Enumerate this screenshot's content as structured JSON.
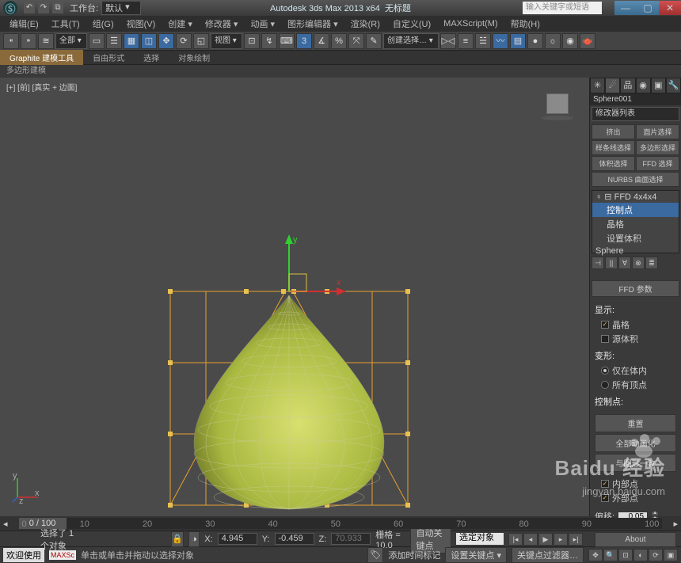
{
  "title": {
    "workspace_label": "工作台:",
    "workspace_value": "默认",
    "app": "Autodesk 3ds Max  2013 x64",
    "doc": "无标题",
    "search_placeholder": "输入关键字或短语"
  },
  "menu": [
    "编辑(E)",
    "工具(T)",
    "组(G)",
    "视图(V)",
    "创建 ▾",
    "修改器 ▾",
    "动画 ▾",
    "图形编辑器 ▾",
    "渲染(R)",
    "自定义(U)",
    "MAXScript(M)",
    "帮助(H)"
  ],
  "toolbar": {
    "sel_dd": "全部 ▾",
    "view_dd": "视图 ▾",
    "sel_set_dd": "创建选择… ▾"
  },
  "ribbon": {
    "tabs": [
      "Graphite 建模工具",
      "自由形式",
      "选择",
      "对象绘制"
    ],
    "sub": "多边形建模"
  },
  "viewport": {
    "label": "[+] [前] [真实 + 边面]"
  },
  "cmd": {
    "object_name": "Sphere001",
    "modlist_dd": "修改器列表",
    "buttons": {
      "extrude": "挤出",
      "face_sel": "面片选择",
      "spline_sel": "样条线选择",
      "poly_sel": "多边形选择",
      "vol_sel": "体积选择",
      "ffd_sel": "FFD 选择",
      "nurbs": "NURBS 曲面选择"
    },
    "stack": {
      "mod": "FFD 4x4x4",
      "sub1": "控制点",
      "sub2": "晶格",
      "sub3": "设置体积",
      "base": "Sphere"
    },
    "rollout_title": "FFD 参数",
    "display_label": "显示:",
    "lattice": "晶格",
    "source_vol": "源体积",
    "deform_label": "变形:",
    "in_vol": "仅在体内",
    "all_verts": "所有顶点",
    "ctrl_label": "控制点:",
    "reset": "重置",
    "animate_all": "全部动画化",
    "conform": "与图形一致",
    "inner": "内部点",
    "outer": "外部点",
    "offset_label": "偏移:",
    "offset_val": "0.05",
    "about": "About"
  },
  "timeline": {
    "handle": "0 / 100",
    "ticks": [
      "0",
      "10",
      "20",
      "30",
      "40",
      "50",
      "60",
      "70",
      "80",
      "90",
      "100"
    ]
  },
  "status": {
    "sel_count": "选择了 1 个对象",
    "x_label": "X:",
    "x": "4.945",
    "y_label": "Y:",
    "y": "-0.459",
    "z_label": "Z:",
    "z": "70.933",
    "grid_label": "栅格 = 10.0",
    "autokey": "自动关键点",
    "selmode": "选定对象",
    "setkey": "设置关键点 ▾",
    "keyfilter": "关键点过滤器…",
    "welcome": "欢迎使用",
    "maxsc": "MAXSc",
    "prompt": "单击或单击并拖动以选择对象",
    "add_time": "添加时间标记"
  },
  "watermark": {
    "brand": "Baidu 经验",
    "url": "jingyan.baidu.com"
  }
}
